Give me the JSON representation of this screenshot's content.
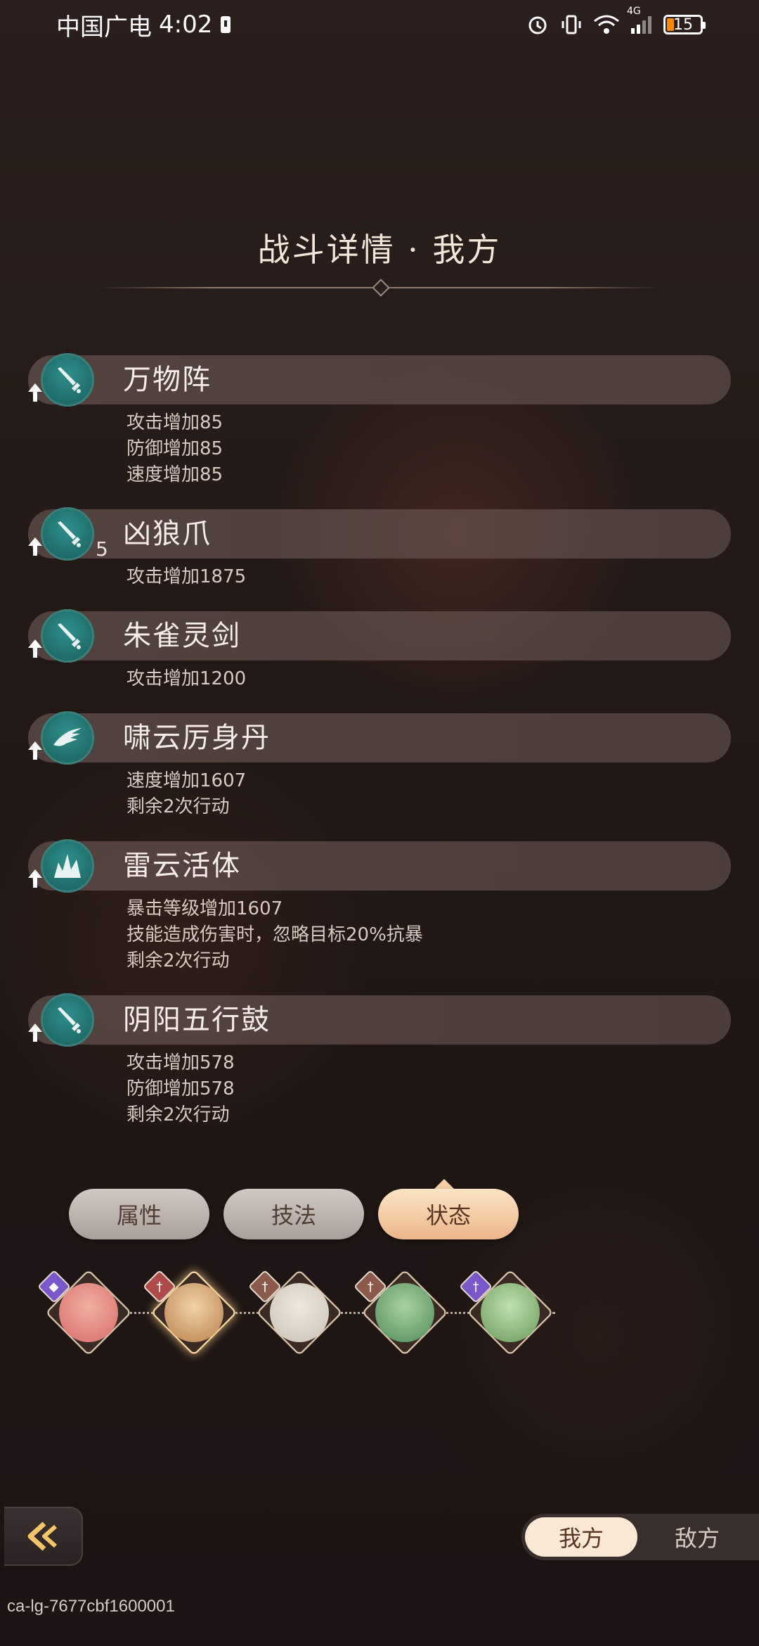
{
  "status_bar": {
    "carrier": "中国广电",
    "time": "4:02",
    "network": "4G",
    "battery": "15"
  },
  "panel": {
    "title": "战斗详情 · 我方"
  },
  "effects": [
    {
      "name": "万物阵",
      "icon": "sword-icon",
      "stack": "",
      "lines": [
        "攻击增加85",
        "防御增加85",
        "速度增加85"
      ]
    },
    {
      "name": "凶狼爪",
      "icon": "sword-icon",
      "stack": "5",
      "lines": [
        "攻击增加1875"
      ]
    },
    {
      "name": "朱雀灵剑",
      "icon": "sword-icon",
      "stack": "",
      "lines": [
        "攻击增加1200"
      ]
    },
    {
      "name": "啸云厉身丹",
      "icon": "wing-icon",
      "stack": "",
      "lines": [
        "速度增加1607",
        "剩余2次行动"
      ]
    },
    {
      "name": "雷云活体",
      "icon": "burst-icon",
      "stack": "",
      "lines": [
        "暴击等级增加1607",
        "技能造成伤害时，忽略目标20%抗暴",
        "剩余2次行动"
      ]
    },
    {
      "name": "阴阳五行鼓",
      "icon": "sword-icon",
      "stack": "",
      "lines": [
        "攻击增加578",
        "防御增加578",
        "剩余2次行动"
      ]
    }
  ],
  "tabs": [
    {
      "label": "属性",
      "active": false
    },
    {
      "label": "技法",
      "active": false
    },
    {
      "label": "状态",
      "active": true
    }
  ],
  "roster": [
    {
      "name": "character-1",
      "badge_color": "#7a58c9",
      "face_color": "#d86b6b"
    },
    {
      "name": "character-2",
      "badge_color": "#b04a4a",
      "face_color": "#b8804a"
    },
    {
      "name": "character-3",
      "badge_color": "#8a5a4a",
      "face_color": "#c9c2b5"
    },
    {
      "name": "character-4",
      "badge_color": "#8a5a4a",
      "face_color": "#4f8a5a"
    },
    {
      "name": "character-5",
      "badge_color": "#7a58c9",
      "face_color": "#6a9a5a"
    }
  ],
  "side_toggle": {
    "ours": "我方",
    "enemy": "敌方"
  },
  "build_id": "ca-lg-7677cbf1600001"
}
